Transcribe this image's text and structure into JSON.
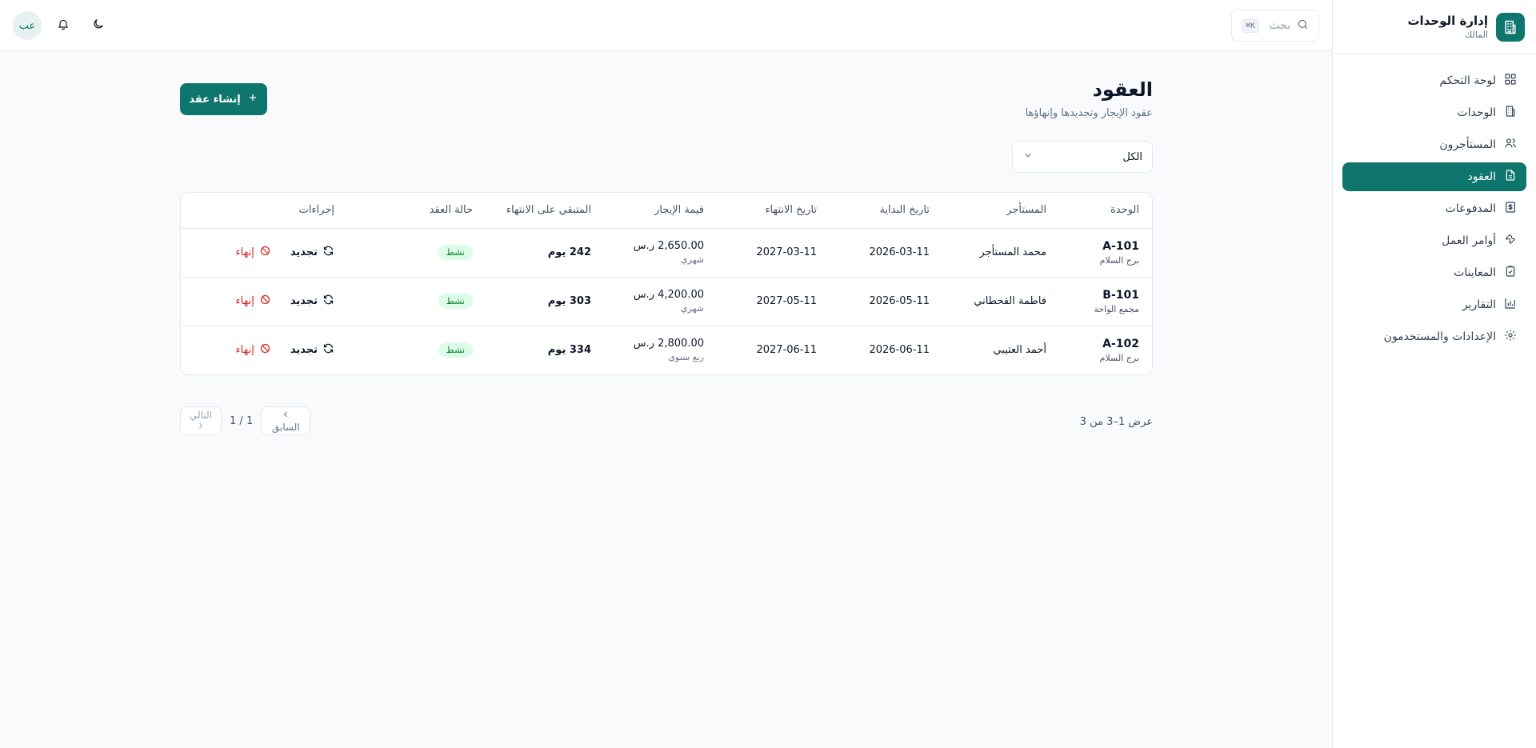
{
  "app": {
    "title": "إدارة الوحدات",
    "role": "المالك"
  },
  "sidebar": {
    "items": [
      {
        "label": "لوحة التحكم",
        "icon": "dashboard-icon"
      },
      {
        "label": "الوحدات",
        "icon": "building-icon"
      },
      {
        "label": "المستأجرون",
        "icon": "users-icon"
      },
      {
        "label": "العقود",
        "icon": "contract-icon",
        "active": true
      },
      {
        "label": "المدفوعات",
        "icon": "payments-icon"
      },
      {
        "label": "أوامر العمل",
        "icon": "wrench-icon"
      },
      {
        "label": "المعاينات",
        "icon": "clipboard-check-icon"
      },
      {
        "label": "التقارير",
        "icon": "chart-icon"
      },
      {
        "label": "الإعدادات والمستخدمون",
        "icon": "gear-icon"
      }
    ]
  },
  "topbar": {
    "search_placeholder": "بحث",
    "shortcut": "K⌘",
    "avatar_initials": "عب"
  },
  "page": {
    "title": "العقود",
    "subtitle": "عقود الإيجار وتجديدها وإنهاؤها",
    "create_button": "إنشاء عقد",
    "filter_value": "الكل"
  },
  "table": {
    "headers": {
      "unit": "الوحدة",
      "tenant": "المستأجر",
      "start": "تاريخ البداية",
      "end": "تاريخ الانتهاء",
      "rent": "قيمة الإيجار",
      "remaining": "المتبقي على الانتهاء",
      "status": "حالة العقد",
      "actions": "إجراءات"
    },
    "rows": [
      {
        "unit": "A-101",
        "building": "برج السلام",
        "tenant": "محمد المستأجر",
        "start": "2026-03-11",
        "end": "2027-03-11",
        "rent": "2,650.00 ر.س",
        "period": "شهري",
        "remaining": "242 يوم",
        "status": "نشط",
        "renew": "تجديد",
        "terminate": "إنهاء"
      },
      {
        "unit": "B-101",
        "building": "مجمع الواحة",
        "tenant": "فاطمة القحطاني",
        "start": "2026-05-11",
        "end": "2027-05-11",
        "rent": "4,200.00 ر.س",
        "period": "شهري",
        "remaining": "303 يوم",
        "status": "نشط",
        "renew": "تجديد",
        "terminate": "إنهاء"
      },
      {
        "unit": "A-102",
        "building": "برج السلام",
        "tenant": "أحمد العتيبي",
        "start": "2026-06-11",
        "end": "2027-06-11",
        "rent": "2,800.00 ر.س",
        "period": "ربع سنوي",
        "remaining": "334 يوم",
        "status": "نشط",
        "renew": "تجديد",
        "terminate": "إنهاء"
      }
    ]
  },
  "pagination": {
    "showing": "عرض 1–3 من 3",
    "prev": "السابق",
    "next": "التالي",
    "page_indicator": "1 / 1"
  },
  "colors": {
    "brand": "#0f766e",
    "active_badge_bg": "#dcfce7",
    "active_badge_text": "#15803d",
    "danger": "#dc2626"
  }
}
